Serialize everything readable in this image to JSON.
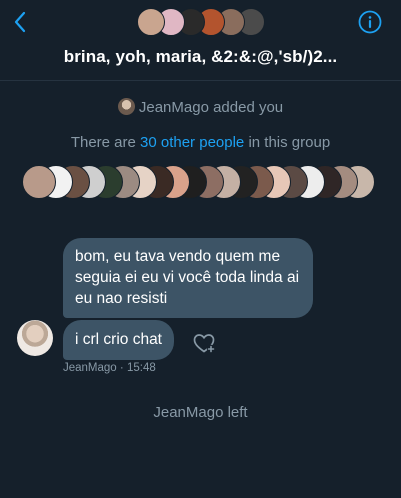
{
  "header": {
    "title": "brina, yoh, maria, &2:&:@,'sb/)2...",
    "back_icon": "chevron-left-icon",
    "info_icon": "info-icon",
    "avatar_colors": [
      "#c9a58f",
      "#e0b7c4",
      "#2a2a2a",
      "#b3542e",
      "#8a6d5d",
      "#4b4b4b"
    ]
  },
  "conversation": {
    "added_notice": "JeanMago added you",
    "others_prefix": "There are ",
    "others_link": "30 other people",
    "others_suffix": " in this group",
    "member_avatar_colors": [
      "#b89a8a",
      "#f2f2f2",
      "#6a5043",
      "#cfcfcf",
      "#2b3d2e",
      "#9c8b82",
      "#e6d3c6",
      "#3a2a24",
      "#d9a28b",
      "#1f1f1f",
      "#8d6e63",
      "#c4b0a4",
      "#222222",
      "#7b5a4c",
      "#e7c7b7",
      "#5b4a44",
      "#ededed",
      "#2f2626",
      "#a48c80",
      "#c8b7aa"
    ]
  },
  "messages": [
    {
      "text": "bom, eu tava vendo quem me seguia ei eu vi você toda linda ai eu nao resisti"
    },
    {
      "text": "i crl crio chat"
    }
  ],
  "message_meta": {
    "sender": "JeanMago",
    "separator": " · ",
    "time": "15:48"
  },
  "left_notice": "JeanMago left",
  "colors": {
    "background": "#15202b",
    "bubble": "#3d5466",
    "accent": "#1da1f2",
    "muted": "#8899a6"
  }
}
